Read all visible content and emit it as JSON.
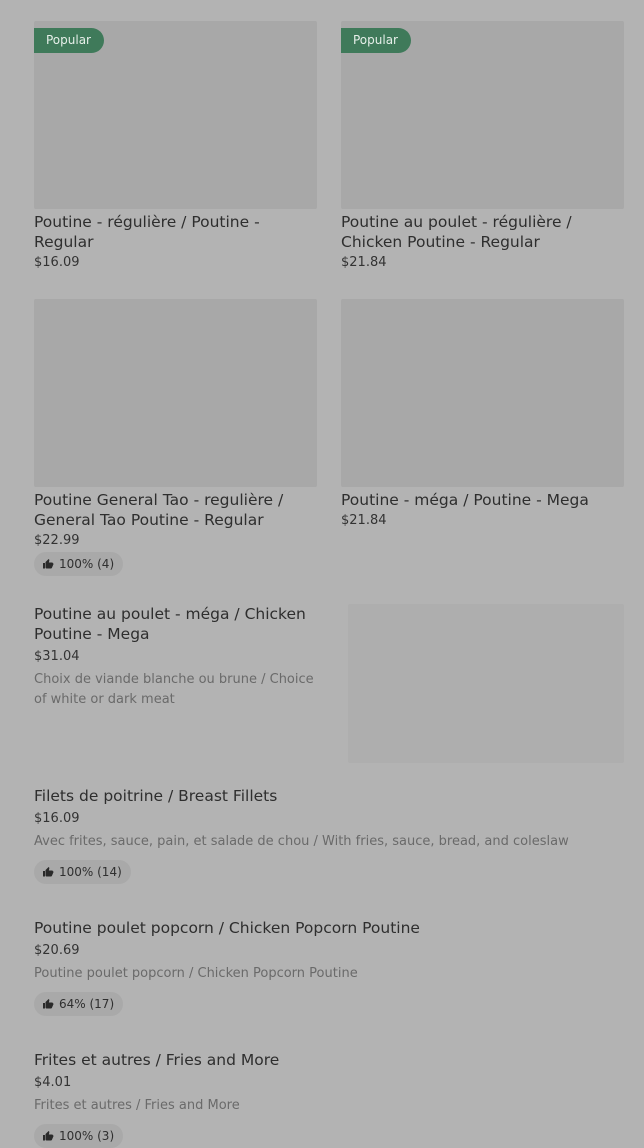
{
  "grid_items": [
    {
      "badge": "Popular",
      "title": "Poutine - régulière / Poutine - Regular",
      "price": "$16.09"
    },
    {
      "badge": "Popular",
      "title": "Poutine au poulet - régulière / Chicken Poutine - Regular",
      "price": "$21.84"
    },
    {
      "title": "Poutine General Tao - regulière / General Tao Poutine - Regular",
      "price": "$22.99",
      "rating": "100% (4)"
    },
    {
      "title": "Poutine - méga / Poutine - Mega",
      "price": "$21.84"
    }
  ],
  "split_item": {
    "title": "Poutine au poulet - méga / Chicken Poutine - Mega",
    "price": "$31.04",
    "desc": "Choix de viande blanche ou brune / Choice of white or dark meat"
  },
  "list_items": [
    {
      "title": "Filets de poitrine / Breast Fillets",
      "price": "$16.09",
      "desc": "Avec frites, sauce, pain, et salade de chou / With fries, sauce, bread, and coleslaw",
      "rating": "100% (14)"
    },
    {
      "title": "Poutine poulet popcorn / Chicken Popcorn Poutine",
      "price": "$20.69",
      "desc": "Poutine poulet popcorn / Chicken Popcorn Poutine",
      "rating": "64% (17)"
    },
    {
      "title": "Frites et autres / Fries and More",
      "price": "$4.01",
      "desc": "Frites et autres / Fries and More",
      "rating": "100% (3)"
    }
  ],
  "icons": {
    "rating": "thumbs-up-icon"
  }
}
